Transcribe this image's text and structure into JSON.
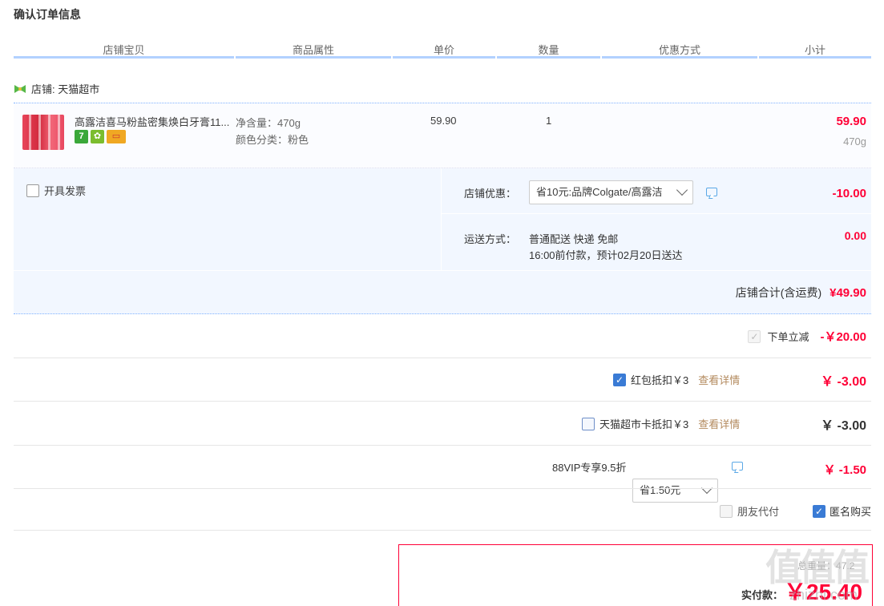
{
  "page": {
    "title": "确认订单信息"
  },
  "columns": [
    "店铺宝贝",
    "商品属性",
    "单价",
    "数量",
    "优惠方式",
    "小计"
  ],
  "shop": {
    "label": "店铺: 天猫超市"
  },
  "item": {
    "title": "高露洁喜马粉盐密集焕白牙膏11...",
    "badges": [
      "7",
      "✿",
      "▭"
    ],
    "attrs": [
      "净含量：470g",
      "颜色分类：粉色"
    ],
    "unit_price": "59.90",
    "quantity": "1",
    "subtotal": "59.90",
    "subtotal_note": "470g"
  },
  "invoice": {
    "label": "开具发票"
  },
  "shop_discount": {
    "label": "店铺优惠：",
    "selected": "省10元:品牌Colgate/高露洁",
    "amount": "-10.00"
  },
  "shipping": {
    "label": "运送方式：",
    "method": "普通配送 快递 免邮",
    "note": "16:00前付款，预计02月20日送达",
    "amount": "0.00"
  },
  "shop_total": {
    "label": "店铺合计(含运费)",
    "amount": "¥49.90"
  },
  "order_discount": {
    "label": "下单立减",
    "amount": "-￥20.00"
  },
  "red_packet": {
    "label": "红包抵扣￥3",
    "link": "查看详情",
    "amount": "￥ -3.00"
  },
  "tmall_card": {
    "label": "天猫超市卡抵扣￥3",
    "link": "查看详情",
    "amount": "￥ -3.00"
  },
  "vip": {
    "label": "88VIP专享9.5折",
    "selected": "省1.50元",
    "amount": "￥ -1.50"
  },
  "friend_pay": {
    "label": "朋友代付"
  },
  "anonymous": {
    "label": "匿名购买"
  },
  "pay": {
    "partial_label": "总重量：",
    "partial_value": "47.2",
    "label": "实付款：",
    "amount": "￥25.40"
  },
  "watermark": {
    "text": "值值值",
    "sub": "zhizhi.com"
  },
  "colors": {
    "accent": "#3a7bd5",
    "price": "#ff0036",
    "header_line": "#b2d1ff",
    "panel": "#f2f7ff"
  }
}
